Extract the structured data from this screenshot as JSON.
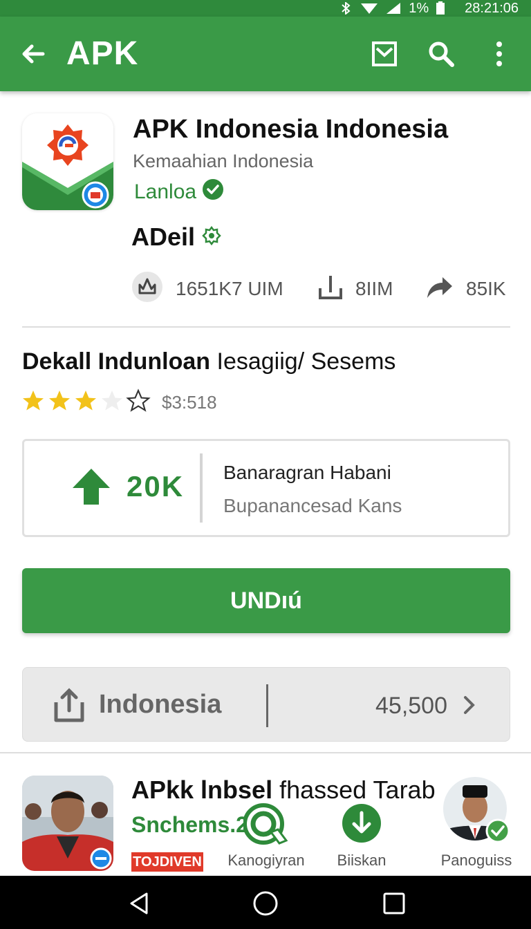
{
  "status_bar": {
    "time": "28:21:06",
    "battery": "1%"
  },
  "app_bar": {
    "title": "APK"
  },
  "app": {
    "title": "APK Indonesia Indonesia",
    "subtitle": "Kemaahian Indonesia",
    "developer": "Lanloa",
    "section_label": "ADeil",
    "stats": [
      {
        "icon": "crown-icon",
        "value": "1651K7 UIM"
      },
      {
        "icon": "download-count-icon",
        "value": "8IIM"
      },
      {
        "icon": "share-icon",
        "value": "85IK"
      }
    ]
  },
  "details": {
    "title_bold": "Dekall Indunloan",
    "title_rest": "Iesagiig/ Sesems",
    "rating_value": "$3:518",
    "stars_filled": 3,
    "stars_total": 5
  },
  "promo": {
    "count": "20K",
    "line1": "Banaragran Habani",
    "line2": "Bupanancesad Kans"
  },
  "primary_button": {
    "label": "UNDıú"
  },
  "language_row": {
    "label": "Indonesia",
    "value": "45,500"
  },
  "related": {
    "title_bold": "APkk lnbsel",
    "title_rest": "fhassed Tarab",
    "subtitle": "Snchems.2",
    "tag": "TOJDIVEN"
  },
  "tabs": [
    {
      "label": "Kanogiyran",
      "icon": "search-icon"
    },
    {
      "label": "Biiskan",
      "icon": "download-icon"
    },
    {
      "label": "Panoguiss",
      "icon": "avatar"
    }
  ],
  "colors": {
    "primary": "#3a9a47",
    "primary_dark": "#2f8a3c",
    "accent_text": "#2e8a3a",
    "tag": "#e03a2a",
    "star": "#f2c21a"
  }
}
